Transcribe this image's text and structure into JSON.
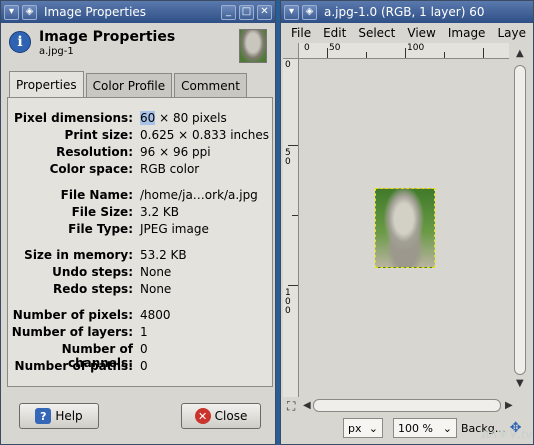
{
  "dialog": {
    "window_title": "Image Properties",
    "header_title": "Image Properties",
    "header_subtitle": "a.jpg-1",
    "tabs": [
      {
        "label": "Properties"
      },
      {
        "label": "Color Profile"
      },
      {
        "label": "Comment"
      }
    ],
    "properties": [
      {
        "key": "Pixel dimensions:",
        "highlight": "60",
        "value": " × 80 pixels"
      },
      {
        "key": "Print size:",
        "value": "0.625 × 0.833 inches"
      },
      {
        "key": "Resolution:",
        "value": "96 × 96 ppi"
      },
      {
        "key": "Color space:",
        "value": "RGB color"
      },
      {
        "key": "File Name:",
        "value": "/home/ja…ork/a.jpg"
      },
      {
        "key": "File Size:",
        "value": "3.2 KB"
      },
      {
        "key": "File Type:",
        "value": "JPEG image"
      },
      {
        "key": "Size in memory:",
        "value": "53.2 KB"
      },
      {
        "key": "Undo steps:",
        "value": "None"
      },
      {
        "key": "Redo steps:",
        "value": "None"
      },
      {
        "key": "Number of pixels:",
        "value": "4800"
      },
      {
        "key": "Number of layers:",
        "value": "1"
      },
      {
        "key": "Number of channels:",
        "value": "0"
      },
      {
        "key": "Number of paths:",
        "value": "0"
      }
    ],
    "help_label": "Help",
    "close_label": "Close"
  },
  "gimp": {
    "window_title": "a.jpg-1.0 (RGB, 1 layer) 60",
    "menus": [
      "File",
      "Edit",
      "Select",
      "View",
      "Image",
      "Laye"
    ],
    "hruler_labels": [
      "0",
      "50",
      "100"
    ],
    "vruler_labels": [
      "0",
      "5\n0",
      "1\n0\n0"
    ],
    "unit": "px",
    "zoom": "100 %",
    "status": "Backg…"
  },
  "watermark": "ᕕᐱᗐᗐ.tv"
}
